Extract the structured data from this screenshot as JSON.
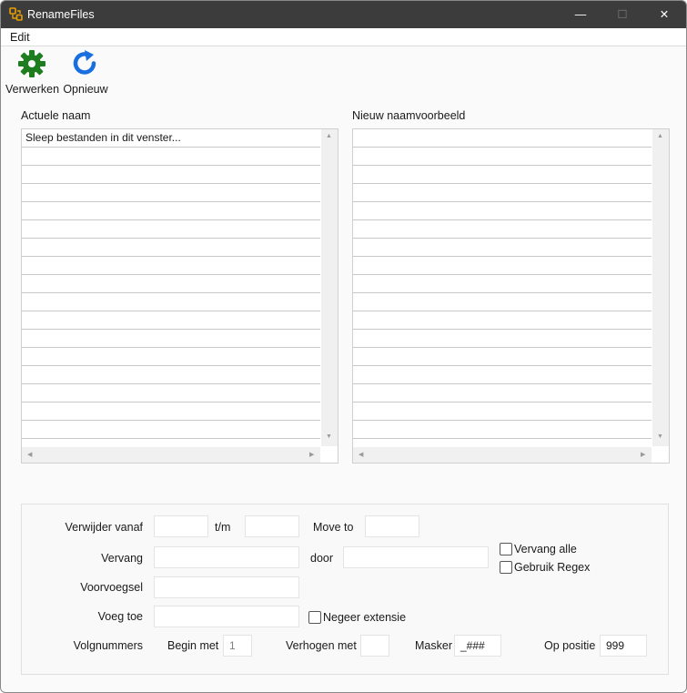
{
  "window": {
    "title": "RenameFiles",
    "controls": {
      "minimize": "—",
      "maximize": "☐",
      "close": "✕"
    }
  },
  "menu": {
    "edit": "Edit"
  },
  "toolbar": {
    "process_label": "Verwerken",
    "reset_label": "Opnieuw"
  },
  "lists": {
    "current": {
      "header": "Actuele naam",
      "placeholder_row": "Sleep bestanden in dit venster..."
    },
    "preview": {
      "header": "Nieuw naamvoorbeeld"
    }
  },
  "form": {
    "remove_from_label": "Verwijder vanaf",
    "to_label": "t/m",
    "move_to_label": "Move to",
    "replace_label": "Vervang",
    "by_label": "door",
    "replace_all_label": "Vervang alle",
    "use_regex_label": "Gebruik Regex",
    "prefix_label": "Voorvoegsel",
    "append_label": "Voeg toe",
    "ignore_ext_label": "Negeer extensie",
    "numbering_label": "Volgnummers",
    "start_label": "Begin met",
    "start_value": "1",
    "increment_label": "Verhogen met",
    "mask_label": "Masker",
    "mask_value": "_###",
    "position_label": "Op positie",
    "position_value": "999"
  },
  "colors": {
    "titlebar": "#3c3c3c",
    "gear": "#1e7d1e",
    "refresh": "#1a6fe0",
    "icon_orange": "#e8a000"
  }
}
